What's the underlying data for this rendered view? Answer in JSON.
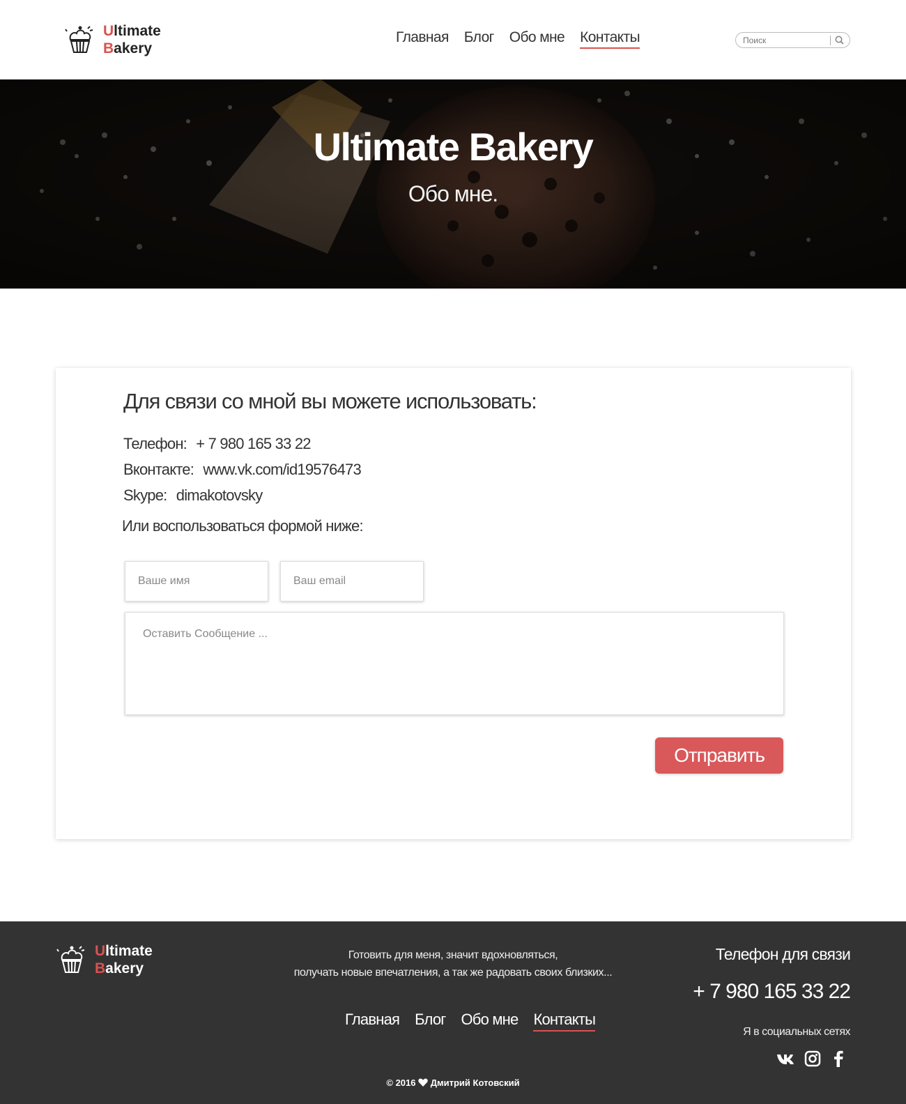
{
  "brand": {
    "line1_accent": "U",
    "line1_rest": "ltimate",
    "line2_accent": "B",
    "line2_rest": "akery",
    "accent_color": "#d9534f"
  },
  "header": {
    "nav": [
      {
        "label": "Главная",
        "active": false
      },
      {
        "label": "Блог",
        "active": false
      },
      {
        "label": "Обо мне",
        "active": false
      },
      {
        "label": "Контакты",
        "active": true
      }
    ],
    "search": {
      "placeholder": "Поиск"
    }
  },
  "hero": {
    "title": "Ultimate Bakery",
    "subtitle": "Обо мне."
  },
  "contact": {
    "heading": "Для связи со мной вы можете использовать:",
    "phone": {
      "label": "Телефон:",
      "value": "+ 7 980 165 33 22"
    },
    "vk": {
      "label": "Вконтакте:",
      "value": "www.vk.com/id19576473"
    },
    "skype": {
      "label": "Skype:",
      "value": "dimakotovsky"
    },
    "form_intro": "Или воспользоваться формой ниже:",
    "form": {
      "name_placeholder": "Ваше имя",
      "email_placeholder": "Ваш email",
      "message_placeholder": "Оставить Сообщение ...",
      "submit_label": "Отправить"
    }
  },
  "footer": {
    "tagline_1": "Готовить для меня, значит вдохновляться,",
    "tagline_2": "получать новые впечатления, а так же радовать своих близких...",
    "nav": [
      {
        "label": "Главная",
        "active": false
      },
      {
        "label": "Блог",
        "active": false
      },
      {
        "label": "Обо мне",
        "active": false
      },
      {
        "label": "Контакты",
        "active": true
      }
    ],
    "phone_label": "Телефон для связи",
    "phone": "+ 7 980 165 33 22",
    "social_label": "Я в социальных сетях",
    "socials": [
      "vk-icon",
      "instagram-icon",
      "facebook-icon"
    ],
    "copyright_year": "© 2016",
    "copyright_name": "Дмитрий Котовский"
  }
}
